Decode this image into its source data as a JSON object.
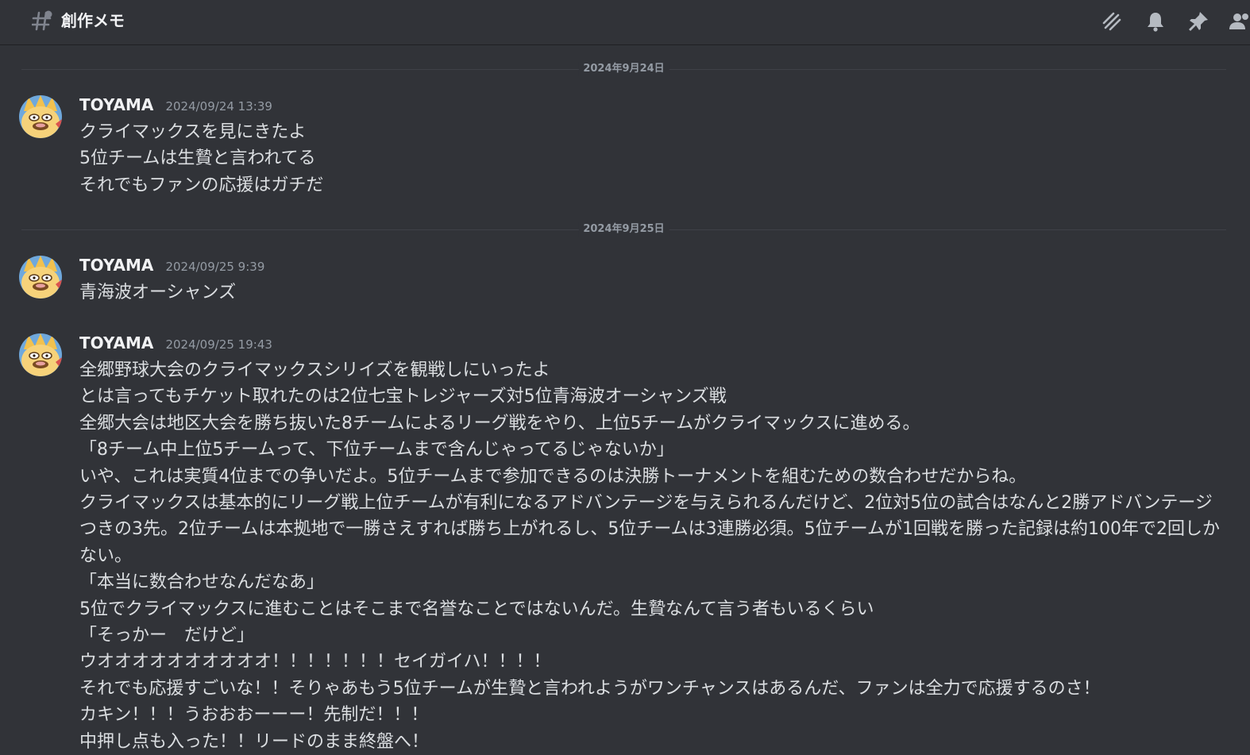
{
  "channel": {
    "name": "創作メモ",
    "hash_icon": "channel-hash-icon",
    "header_icons": [
      "threads-icon",
      "bell-icon",
      "pin-icon",
      "members-icon"
    ]
  },
  "colors": {
    "background": "#313338",
    "author": "#f2f3f5",
    "timestamp": "#949ba4",
    "text": "#dbdee1"
  },
  "dividers": [
    {
      "label": "2024年9月24日"
    },
    {
      "label": "2024年9月25日"
    }
  ],
  "messages": [
    {
      "author": "TOYAMA",
      "timestamp": "2024/09/24 13:39",
      "avatar": "cat-avatar-icon",
      "lines": [
        "クライマックスを見にきたよ",
        "5位チームは生贄と言われてる",
        "それでもファンの応援はガチだ"
      ]
    },
    {
      "author": "TOYAMA",
      "timestamp": "2024/09/25 9:39",
      "avatar": "cat-avatar-icon",
      "lines": [
        "青海波オーシャンズ"
      ]
    },
    {
      "author": "TOYAMA",
      "timestamp": "2024/09/25 19:43",
      "avatar": "cat-avatar-icon",
      "lines": [
        "全郷野球大会のクライマックスシリイズを観戦しにいったよ",
        "とは言ってもチケット取れたのは2位七宝トレジャーズ対5位青海波オーシャンズ戦",
        "全郷大会は地区大会を勝ち抜いた8チームによるリーグ戦をやり、上位5チームがクライマックスに進める。",
        "「8チーム中上位5チームって、下位チームまで含んじゃってるじゃないか」",
        "いや、これは実質4位までの争いだよ。5位チームまで参加できるのは決勝トーナメントを組むための数合わせだからね。",
        "クライマックスは基本的にリーグ戦上位チームが有利になるアドバンテージを与えられるんだけど、2位対5位の試合はなんと2勝アドバンテージつきの3先。2位チームは本拠地で一勝さえすれば勝ち上がれるし、5位チームは3連勝必須。5位チームが1回戦を勝った記録は約100年で2回しかない。",
        "「本当に数合わせなんだなあ」",
        "5位でクライマックスに進むことはそこまで名誉なことではないんだ。生贄なんて言う者もいるくらい",
        "「そっかー　だけど」",
        "ウオオオオオオオオオオ！！！！！！！セイガイハ！！！！",
        "それでも応援すごいな！！そりゃあもう5位チームが生贄と言われようがワンチャンスはあるんだ、ファンは全力で応援するのさ！",
        "カキン！！！うおおおーーー！先制だ！！！",
        "中押し点も入った！！リードのまま終盤へ！"
      ]
    }
  ]
}
